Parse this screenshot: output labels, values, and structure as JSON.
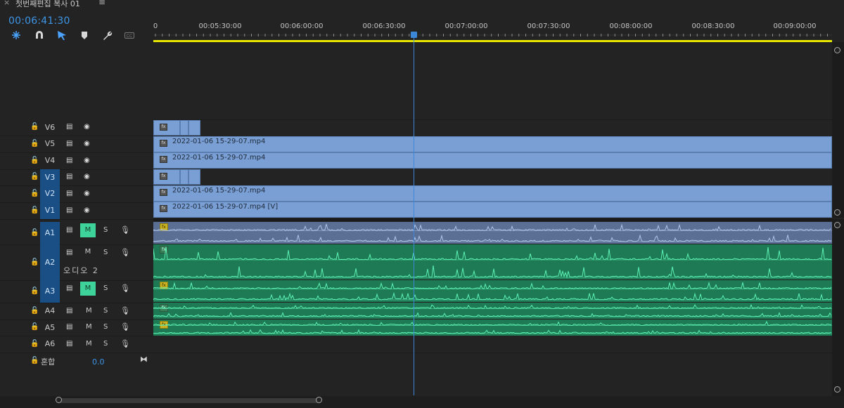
{
  "tab": {
    "close": "×",
    "title": "첫번째편집 복사 01",
    "menu": "≡"
  },
  "timecode": "00:06:41:30",
  "tools": [
    "ripple-icon",
    "magnet-icon",
    "linked-selection-icon",
    "marker-icon",
    "wrench-icon",
    "caption-icon"
  ],
  "ruler": {
    "ticks": [
      "0",
      "00:05:30:00",
      "00:06:00:00",
      "00:06:30:00",
      "00:07:00:00",
      "00:07:30:00",
      "00:08:00:00",
      "00:08:30:00",
      "00:09:00:00"
    ]
  },
  "video_tracks": [
    {
      "name": "V6",
      "selected": false
    },
    {
      "name": "V5",
      "selected": false
    },
    {
      "name": "V4",
      "selected": false
    },
    {
      "name": "V3",
      "selected": true
    },
    {
      "name": "V2",
      "selected": true
    },
    {
      "name": "V1",
      "selected": true
    }
  ],
  "audio_tracks": [
    {
      "name": "A1",
      "selected": true,
      "mute_on": true,
      "label": ""
    },
    {
      "name": "A2",
      "selected": true,
      "mute_on": false,
      "label": "오디오 2"
    },
    {
      "name": "A3",
      "selected": true,
      "mute_on": true,
      "label": ""
    },
    {
      "name": "A4",
      "selected": false,
      "mute_on": false,
      "label": ""
    },
    {
      "name": "A5",
      "selected": false,
      "mute_on": false,
      "label": ""
    },
    {
      "name": "A6",
      "selected": false,
      "mute_on": false,
      "label": ""
    }
  ],
  "mix": {
    "label": "혼합",
    "value": "0.0"
  },
  "buttons": {
    "mute": "M",
    "solo": "S"
  },
  "clips": {
    "v5": "2022-01-06 15-29-07.mp4",
    "v4": "2022-01-06 15-29-07.mp4",
    "v2": "2022-01-06 15-29-07.mp4",
    "v1": "2022-01-06 15-29-07.mp4 [V]",
    "fx_label": "fx"
  },
  "colors": {
    "accent": "#3d95e6",
    "video_clip": "#7a9fd4",
    "audio_clip_a1": "#5b6f95",
    "audio_clip": "#1e7a55",
    "mute_on": "#3ed39a",
    "work_area": "#e6e600"
  }
}
